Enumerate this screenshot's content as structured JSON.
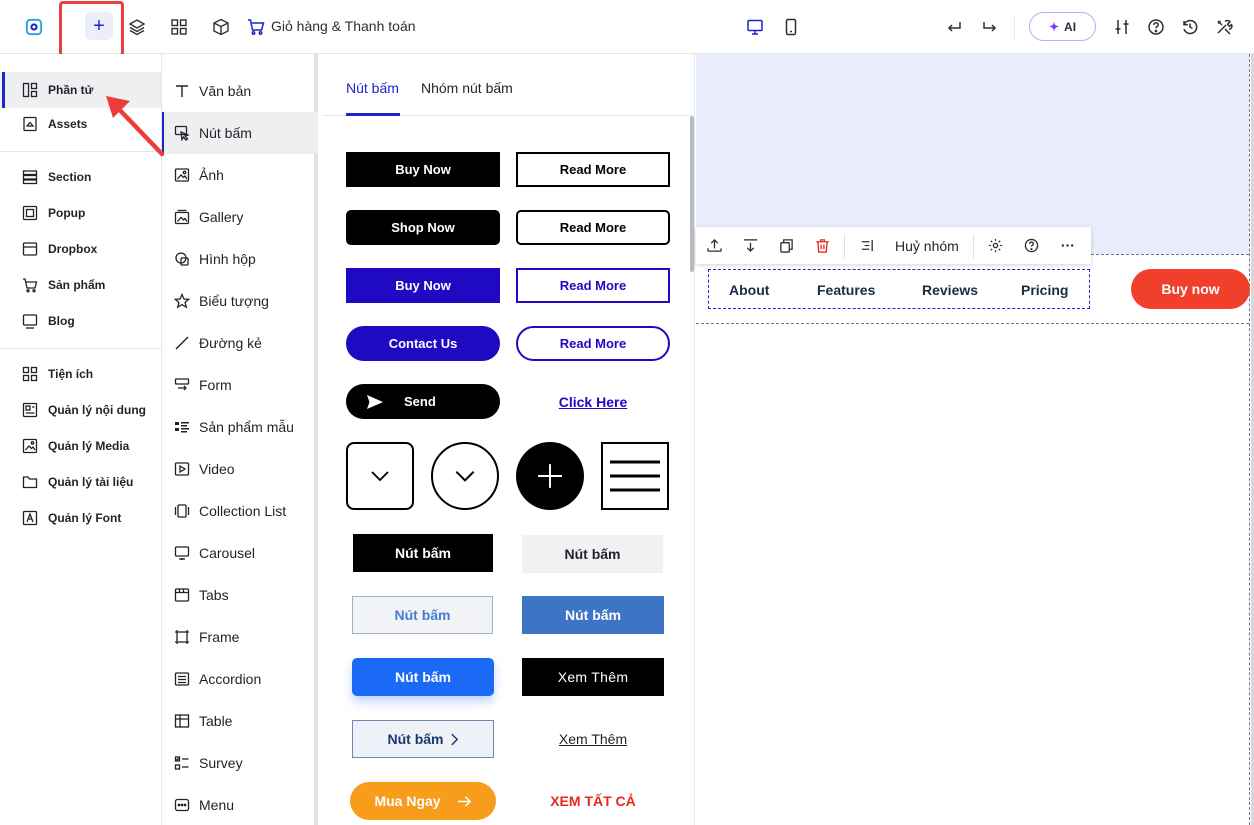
{
  "topbar": {
    "cart_label": "Giỏ hàng & Thanh toán",
    "ai_label": "AI",
    "add_label": "+"
  },
  "leftnav": {
    "items": [
      {
        "label": "Phần tử",
        "icon": "elements-icon"
      },
      {
        "label": "Assets",
        "icon": "assets-icon"
      },
      {
        "label": "Section",
        "icon": "section-icon"
      },
      {
        "label": "Popup",
        "icon": "popup-icon"
      },
      {
        "label": "Dropbox",
        "icon": "dropbox-icon"
      },
      {
        "label": "Sản phẩm",
        "icon": "cart-icon"
      },
      {
        "label": "Blog",
        "icon": "blog-icon"
      },
      {
        "label": "Tiện ích",
        "icon": "apps-icon"
      },
      {
        "label": "Quản lý nội dung",
        "icon": "content-icon"
      },
      {
        "label": "Quản lý Media",
        "icon": "media-icon"
      },
      {
        "label": "Quản lý tài liệu",
        "icon": "folder-icon"
      },
      {
        "label": "Quản lý Font",
        "icon": "font-icon"
      }
    ]
  },
  "elements": {
    "items": [
      {
        "label": "Văn bản"
      },
      {
        "label": "Nút bấm"
      },
      {
        "label": "Ảnh"
      },
      {
        "label": "Gallery"
      },
      {
        "label": "Hình hộp"
      },
      {
        "label": "Biểu tượng"
      },
      {
        "label": "Đường kẻ"
      },
      {
        "label": "Form"
      },
      {
        "label": "Sản phẩm mẫu"
      },
      {
        "label": "Video"
      },
      {
        "label": "Collection List"
      },
      {
        "label": "Carousel"
      },
      {
        "label": "Tabs"
      },
      {
        "label": "Frame"
      },
      {
        "label": "Accordion"
      },
      {
        "label": "Table"
      },
      {
        "label": "Survey"
      },
      {
        "label": "Menu"
      }
    ]
  },
  "gallery": {
    "tabs": [
      "Nút bấm",
      "Nhóm nút bấm"
    ],
    "buttons": {
      "buy_now": "Buy Now",
      "read_more": "Read More",
      "shop_now": "Shop Now",
      "contact_us": "Contact Us",
      "send": "Send",
      "click_here": "Click Here",
      "nut_bam": "Nút bấm",
      "xem_them": "Xem Thêm",
      "mua_ngay": "Mua Ngay",
      "xem_tat_ca": "XEM TẤT CẢ"
    }
  },
  "canvas": {
    "toolbar_ungroup": "Huỷ nhóm",
    "nav_links": [
      "About",
      "Features",
      "Reviews",
      "Pricing"
    ],
    "buy_now": "Buy now",
    "colors": {
      "brand": "#1d24c9",
      "cta": "#f0402c",
      "canvas_bg": "#e8ecfb"
    }
  }
}
